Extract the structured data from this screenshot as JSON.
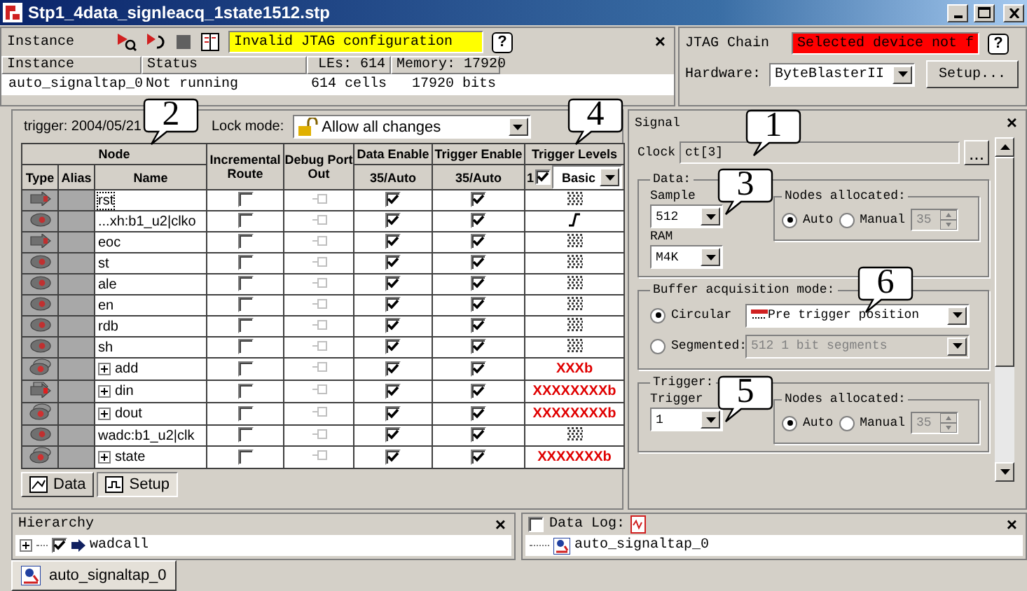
{
  "window": {
    "title": "Stp1_4data_signleacq_1state1512.stp"
  },
  "instance_panel": {
    "title": "Instance",
    "status_message": "Invalid JTAG configuration",
    "help": "?",
    "close": "×",
    "columns": [
      "Instance",
      "Status",
      "LEs: 614",
      "Memory: 17920"
    ],
    "rows": [
      {
        "instance": "auto_signaltap_0",
        "status": "Not running",
        "les": "614 cells",
        "memory": "17920 bits"
      }
    ]
  },
  "jtag_chain": {
    "title": "JTAG Chain",
    "status_message": "Selected device not f",
    "help": "?",
    "hardware_label": "Hardware:",
    "hardware": "ByteBlasterII",
    "setup_button": "Setup..."
  },
  "setup": {
    "trigger_label": "trigger: 2004/05/21",
    "lock_mode_label": "Lock mode:",
    "lock_mode": "Allow all changes",
    "header": {
      "node": "Node",
      "type": "Type",
      "alias": "Alias",
      "name": "Name",
      "incremental_route": "Incremental Route",
      "debug_port_out": "Debug Port Out",
      "data_enable": "Data Enable",
      "data_enable_count": "35/Auto",
      "trigger_enable": "Trigger Enable",
      "trigger_enable_count": "35/Auto",
      "trigger_levels": "Trigger Levels",
      "trigger_level_count": "1",
      "trigger_level_checked": true,
      "trigger_condition": "Basic"
    },
    "rows": [
      {
        "kind": "input",
        "name": "rst",
        "expandable": false,
        "selected": true,
        "incremental_route": false,
        "data_enable": true,
        "trigger_enable": true,
        "trigger_level": {
          "kind": "pattern"
        }
      },
      {
        "kind": "node",
        "name": "...xh:b1_u2|clko",
        "expandable": false,
        "selected": false,
        "incremental_route": false,
        "data_enable": true,
        "trigger_enable": true,
        "trigger_level": {
          "kind": "edge"
        }
      },
      {
        "kind": "input",
        "name": "eoc",
        "expandable": false,
        "selected": false,
        "incremental_route": false,
        "data_enable": true,
        "trigger_enable": true,
        "trigger_level": {
          "kind": "pattern"
        }
      },
      {
        "kind": "node",
        "name": "st",
        "expandable": false,
        "selected": false,
        "incremental_route": false,
        "data_enable": true,
        "trigger_enable": true,
        "trigger_level": {
          "kind": "pattern"
        }
      },
      {
        "kind": "node",
        "name": "ale",
        "expandable": false,
        "selected": false,
        "incremental_route": false,
        "data_enable": true,
        "trigger_enable": true,
        "trigger_level": {
          "kind": "pattern"
        }
      },
      {
        "kind": "node",
        "name": "en",
        "expandable": false,
        "selected": false,
        "incremental_route": false,
        "data_enable": true,
        "trigger_enable": true,
        "trigger_level": {
          "kind": "pattern"
        }
      },
      {
        "kind": "node",
        "name": "rdb",
        "expandable": false,
        "selected": false,
        "incremental_route": false,
        "data_enable": true,
        "trigger_enable": true,
        "trigger_level": {
          "kind": "pattern"
        }
      },
      {
        "kind": "node",
        "name": "sh",
        "expandable": false,
        "selected": false,
        "incremental_route": false,
        "data_enable": true,
        "trigger_enable": true,
        "trigger_level": {
          "kind": "pattern"
        }
      },
      {
        "kind": "bus",
        "name": "add",
        "expandable": true,
        "selected": false,
        "incremental_route": false,
        "data_enable": true,
        "trigger_enable": true,
        "trigger_level": {
          "kind": "value",
          "text": "XXXb"
        }
      },
      {
        "kind": "bus_input",
        "name": "din",
        "expandable": true,
        "selected": false,
        "incremental_route": false,
        "data_enable": true,
        "trigger_enable": true,
        "trigger_level": {
          "kind": "value",
          "text": "XXXXXXXXb"
        }
      },
      {
        "kind": "bus",
        "name": "dout",
        "expandable": true,
        "selected": false,
        "incremental_route": false,
        "data_enable": true,
        "trigger_enable": true,
        "trigger_level": {
          "kind": "value",
          "text": "XXXXXXXXb"
        }
      },
      {
        "kind": "node",
        "name": "wadc:b1_u2|clk",
        "expandable": false,
        "selected": false,
        "incremental_route": false,
        "data_enable": true,
        "trigger_enable": true,
        "trigger_level": {
          "kind": "pattern"
        }
      },
      {
        "kind": "bus",
        "name": "state",
        "expandable": true,
        "selected": false,
        "incremental_route": false,
        "data_enable": true,
        "trigger_enable": true,
        "trigger_level": {
          "kind": "value",
          "text": "XXXXXXXb"
        }
      }
    ]
  },
  "tabs": [
    {
      "label": "Data",
      "selected": false
    },
    {
      "label": "Setup",
      "selected": true
    }
  ],
  "signal_panel": {
    "title": "Signal",
    "close": "×",
    "clock_label": "Clock",
    "clock": "ct[3]",
    "browse_button": "...",
    "data": {
      "title": "Data:",
      "sample_label": "Sample",
      "sample": "512",
      "ram_label": "RAM",
      "ram": "M4K",
      "nodes_allocated": {
        "title": "Nodes allocated:",
        "options": [
          {
            "label": "Auto",
            "selected": true
          },
          {
            "label": "Manual",
            "selected": false
          }
        ],
        "count": "35"
      }
    },
    "buffer": {
      "title": "Buffer acquisition mode:",
      "options": [
        {
          "label": "Circular",
          "selected": true,
          "value": "Pre trigger position",
          "disabled": false
        },
        {
          "label": "Segmented:",
          "selected": false,
          "value": "512  1 bit segments",
          "disabled": true
        }
      ]
    },
    "trigger": {
      "title": "Trigger:",
      "trigger_label": "Trigger",
      "trigger": "1",
      "nodes_allocated": {
        "title": "Nodes allocated:",
        "options": [
          {
            "label": "Auto",
            "selected": true
          },
          {
            "label": "Manual",
            "selected": false
          }
        ],
        "count": "35"
      }
    }
  },
  "hierarchy": {
    "title": "Hierarchy",
    "close": "×",
    "items": [
      {
        "label": "wadcall",
        "checked": true,
        "expanded": false
      }
    ]
  },
  "data_log": {
    "label": "Data Log:",
    "checked": false,
    "close": "×",
    "items": [
      {
        "label": "auto_signaltap_0"
      }
    ]
  },
  "instance_tabs": [
    {
      "label": "auto_signaltap_0",
      "selected": true
    }
  ],
  "callouts": [
    {
      "label": "2"
    },
    {
      "label": "4"
    },
    {
      "label": "1"
    },
    {
      "label": "3"
    },
    {
      "label": "6"
    },
    {
      "label": "5"
    }
  ]
}
